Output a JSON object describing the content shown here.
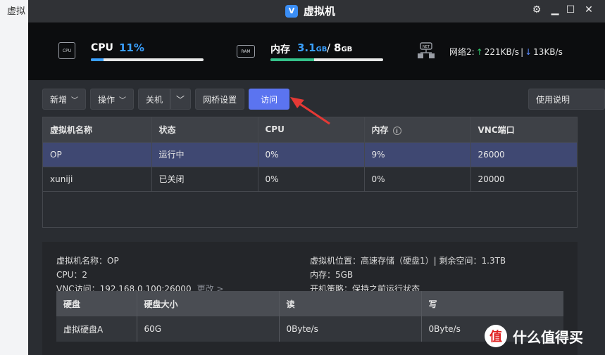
{
  "background": {
    "tab_fragment": "虚拟"
  },
  "window": {
    "title": "虚拟机",
    "controls": {
      "settings": "⚙",
      "minimize": "▁",
      "maximize": "☐",
      "close": "✕"
    }
  },
  "stats": {
    "cpu": {
      "chip_label": "CPU",
      "label": "CPU",
      "value": "11%",
      "usage_fraction": 0.11
    },
    "mem": {
      "chip_label": "RAM",
      "label": "内存",
      "used": "3.1",
      "used_unit": "GB",
      "sep": "/",
      "total": "8",
      "total_unit": "GB",
      "usage_fraction": 0.39
    },
    "net": {
      "chip_label": "NET",
      "label": "网络2:",
      "up_arrow": "↑",
      "up": "221KB/s",
      "divider": "|",
      "down_arrow": "↓",
      "down": "13KB/s"
    }
  },
  "toolbar": {
    "add": "新增",
    "operate": "操作",
    "shutdown": "关机",
    "bridge": "网桥设置",
    "visit": "访问",
    "help": "使用说明"
  },
  "vm_table": {
    "headers": [
      "虚拟机名称",
      "状态",
      "CPU",
      "内存",
      "VNC端口"
    ],
    "rows": [
      [
        "OP",
        "运行中",
        "0%",
        "9%",
        "26000"
      ],
      [
        "xuniji",
        "已关闭",
        "0%",
        "0%",
        "20000"
      ]
    ]
  },
  "detail": {
    "name": "虚拟机名称：OP",
    "cpu": "CPU：2",
    "vnc": "VNC访问：192.168.0.100:26000",
    "vnc_more": "更改 >",
    "location": "虚拟机位置：高速存储（硬盘1）| 剩余空间：1.3TB",
    "memory": "内存：5GB",
    "boot": "开机策略：保持之前运行状态"
  },
  "disk_table": {
    "headers": [
      "硬盘",
      "硬盘大小",
      "读",
      "写"
    ],
    "rows": [
      [
        "虚拟硬盘A",
        "60G",
        "0Byte/s",
        "0Byte/s"
      ]
    ]
  },
  "watermark": {
    "logo": "值",
    "text": "什么值得买"
  },
  "colors": {
    "accent": "#5b74f0",
    "cpu_bar": "#3aa0ff",
    "mem_bar": "#35c28a",
    "up": "#2ec76b",
    "down": "#5a8cff",
    "arrow": "#e53935"
  }
}
